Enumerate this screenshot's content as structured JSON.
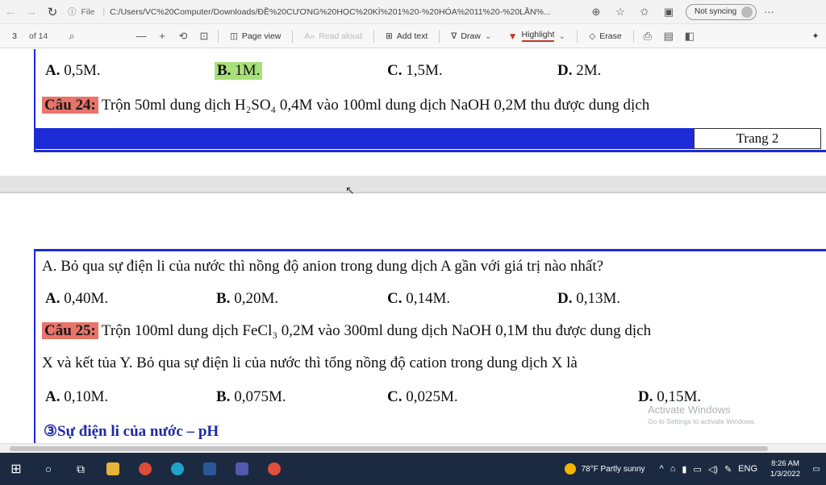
{
  "browser": {
    "file_label": "File",
    "address": "C:/Users/VC%20Computer/Downloads/ĐỀ%20CƯƠNG%20HỌC%20KÌ%201%20-%20HÓA%2011%20-%20LẦN%...",
    "sync_label": "Not syncing",
    "more": "···"
  },
  "pdf_toolbar": {
    "page_number": "3",
    "page_total": "of 14",
    "minus": "—",
    "plus": "+",
    "page_view": "Page view",
    "read_aloud": "Read aloud",
    "add_text": "Add text",
    "draw": "Draw",
    "highlight": "Highlight",
    "erase": "Erase"
  },
  "page1": {
    "options": [
      {
        "letter": "A.",
        "text": "0,5M."
      },
      {
        "letter": "B.",
        "text": "1M."
      },
      {
        "letter": "C.",
        "text": "1,5M."
      },
      {
        "letter": "D.",
        "text": "2M."
      }
    ],
    "question_label": "Câu 24:",
    "question_text": "Trộn 50ml dung dịch H₂SO₄ 0,4M vào 100ml dung dịch NaOH 0,2M thu được dung dịch",
    "footer_page": "Trang 2"
  },
  "page2": {
    "line1": "A. Bỏ qua sự điện li của nước thì nồng độ anion trong dung dịch A gần với giá trị nào nhất?",
    "options1": [
      {
        "letter": "A.",
        "text": "0,40M."
      },
      {
        "letter": "B.",
        "text": "0,20M."
      },
      {
        "letter": "C.",
        "text": "0,14M."
      },
      {
        "letter": "D.",
        "text": "0,13M."
      }
    ],
    "question_label": "Câu 25:",
    "question_text": "Trộn 100ml dung dịch FeCl₃ 0,2M vào 300ml dung dịch NaOH 0,1M thu được dung dịch",
    "question_text2": "X và kết tủa Y. Bỏ qua sự điện li của nước thì tổng nồng độ cation trong dung dịch X là",
    "options2": [
      {
        "letter": "A.",
        "text": "0,10M."
      },
      {
        "letter": "B.",
        "text": "0,075M."
      },
      {
        "letter": "C.",
        "text": "0,025M."
      },
      {
        "letter": "D.",
        "text": "0,15M."
      }
    ],
    "section_heading": "③Sự điện li của nước – pH"
  },
  "watermark": {
    "line1": "Activate Windows",
    "line2": "Go to Settings to activate Windows."
  },
  "taskbar": {
    "weather": "78°F  Partly sunny",
    "lang": "ENG",
    "time": "8:26 AM",
    "date": "1/3/2022"
  },
  "colors": {
    "page_border": "#1d2bd6",
    "question_label_bg": "#e8746a",
    "answer_highlight": "#a8e07a",
    "section_heading": "#1f2aa8",
    "taskbar_bg": "#1b2a40"
  }
}
